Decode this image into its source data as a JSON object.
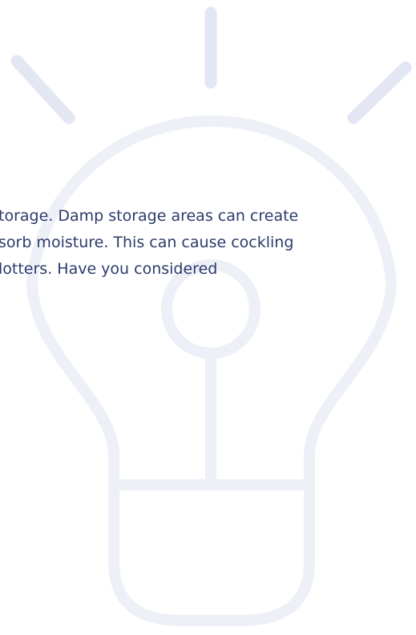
{
  "illustration": {
    "icon": "lightbulb-icon",
    "stroke_color": "#eef0f8",
    "ray_color": "#e3e6f3"
  },
  "body_text": {
    "lines": [
      "torage. Damp storage areas can create",
      "sorb moisture. This can cause cockling",
      "lotters. Have you considered"
    ]
  },
  "colors": {
    "text": "#2d3a6b",
    "background": "#ffffff"
  }
}
